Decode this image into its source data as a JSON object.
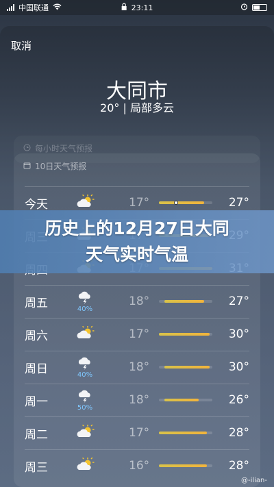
{
  "status": {
    "carrier": "中国联通",
    "time": "23:11"
  },
  "header": {
    "cancel_label": "取消",
    "city": "大同市",
    "current": "20° | 局部多云"
  },
  "hourly": {
    "title": "每小时天气预报"
  },
  "daily": {
    "title": "10日天气预报",
    "rows": [
      {
        "day": "今天",
        "icon": "partly-cloudy-sun-icon",
        "precip": "",
        "low": "17°",
        "high": "27°",
        "bar": [
          0.0,
          0.85
        ]
      },
      {
        "day": "周三",
        "icon": "partly-cloudy-sun-icon",
        "precip": "",
        "low": "17°",
        "high": "29°",
        "bar": [
          0.0,
          0.95
        ]
      },
      {
        "day": "周四",
        "icon": "partly-cloudy-sun-icon",
        "precip": "",
        "low": "17°",
        "high": "31°",
        "bar": [
          0.0,
          1.0
        ]
      },
      {
        "day": "周五",
        "icon": "thunderstorm-icon",
        "precip": "40%",
        "low": "18°",
        "high": "27°",
        "bar": [
          0.1,
          0.85
        ]
      },
      {
        "day": "周六",
        "icon": "partly-cloudy-sun-icon",
        "precip": "",
        "low": "17°",
        "high": "30°",
        "bar": [
          0.0,
          0.95
        ]
      },
      {
        "day": "周日",
        "icon": "thunderstorm-icon",
        "precip": "40%",
        "low": "18°",
        "high": "30°",
        "bar": [
          0.1,
          0.95
        ]
      },
      {
        "day": "周一",
        "icon": "thunderstorm-icon",
        "precip": "50%",
        "low": "18°",
        "high": "26°",
        "bar": [
          0.1,
          0.75
        ]
      },
      {
        "day": "周二",
        "icon": "partly-cloudy-sun-icon",
        "precip": "",
        "low": "17°",
        "high": "28°",
        "bar": [
          0.0,
          0.9
        ]
      },
      {
        "day": "周三",
        "icon": "partly-cloudy-sun-icon",
        "precip": "",
        "low": "16°",
        "high": "28°",
        "bar": [
          0.0,
          0.9
        ]
      }
    ]
  },
  "banner": {
    "line1": "历史上的12月27日大同",
    "line2": "天气实时气温"
  },
  "watermark": "@-ilian-"
}
